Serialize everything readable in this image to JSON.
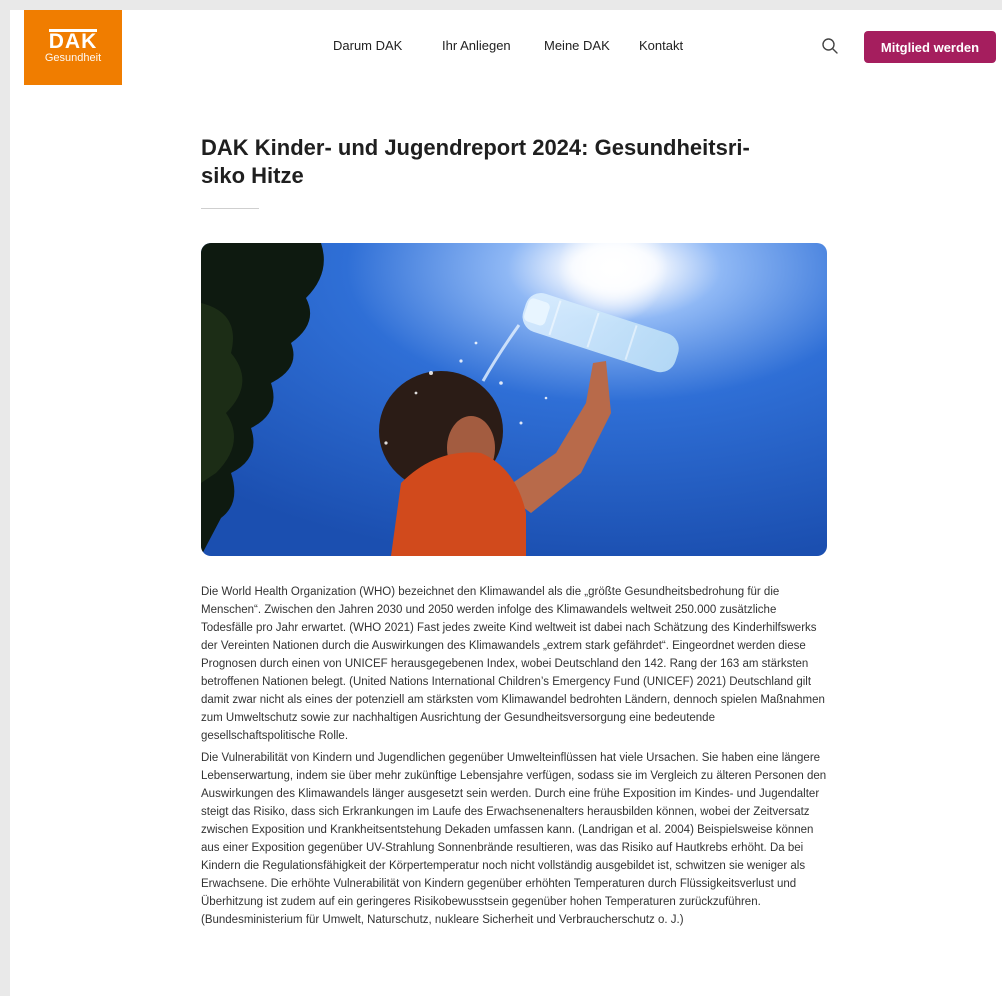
{
  "header": {
    "logo": {
      "mark": "DAK",
      "sub": "Gesundheit"
    },
    "nav": [
      {
        "label": "Darum DAK"
      },
      {
        "label": "Ihr Anliegen"
      },
      {
        "label": "Meine DAK"
      },
      {
        "label": "Kontakt"
      }
    ],
    "search_icon": "search-icon",
    "cta_label": "Mitglied werden"
  },
  "colors": {
    "brand_orange": "#f07d00",
    "cta_magenta": "#a51e5e",
    "sky_blue": "#2f6fd6"
  },
  "article": {
    "title_line1": "DAK Kinder- und Jugendreport 2024: Gesundheitsri-",
    "title_line2": "siko Hitze",
    "hero_image": "child-drinking-water-bottle-under-sun",
    "paragraphs": [
      "Die World Health Organization (WHO) bezeichnet den Klimawandel als die „größte Gesundheitsbedrohung für die Menschen“. Zwischen den Jahren 2030 und 2050 werden infolge des Klimawandels weltweit 250.000 zusätzliche Todesfälle pro Jahr erwartet. (WHO 2021) Fast jedes zweite Kind weltweit ist dabei nach Schätzung des Kinderhilfswerks der Vereinten Nationen durch die Auswirkungen des Klimawandels „extrem stark gefährdet“. Eingeordnet werden diese Prognosen durch einen von UNICEF herausgegebenen Index, wobei Deutschland den 142. Rang der 163 am stärksten betroffenen Nationen belegt. (United Nations International Children’s Emergency Fund (UNICEF) 2021) Deutschland gilt damit zwar nicht als eines der potenziell am stärksten vom Klimawandel bedrohten Ländern, dennoch spielen Maßnahmen zum Umweltschutz sowie zur nachhaltigen Ausrichtung der Gesundheitsversorgung eine bedeutende gesellschaftspolitische Rolle.",
      "Die Vulnerabilität von Kindern und Jugendlichen gegenüber Umwelteinflüssen hat viele Ursachen. Sie haben eine längere Lebenserwartung, indem sie über mehr zukünftige Lebensjahre verfügen, sodass sie im Vergleich zu älteren Personen den Auswirkungen des Klimawandels länger ausgesetzt sein werden. Durch eine frühe Exposition im Kindes- und Jugendalter steigt das Risiko, dass sich Erkrankungen im Laufe des Erwachsenenalters herausbilden können, wobei der Zeitversatz zwischen Exposition und Krankheitsentstehung Dekaden umfassen kann. (Landrigan et al. 2004) Beispielsweise können aus einer Exposition gegenüber UV-Strahlung Sonnenbrände resultieren, was das Risiko auf Hautkrebs erhöht. Da bei Kindern die Regulationsfähigkeit der Körpertemperatur noch nicht vollständig ausgebildet ist, schwitzen sie weniger als Erwachsene. Die erhöhte Vulnerabilität von Kindern gegenüber erhöhten Temperaturen durch Flüssigkeitsverlust und Überhitzung ist zudem auf ein geringeres Risikobewusstsein gegenüber hohen Temperaturen zurückzuführen. (Bundesministerium für Umwelt, Naturschutz, nukleare Sicherheit und Verbraucherschutz o. J.)"
    ]
  }
}
